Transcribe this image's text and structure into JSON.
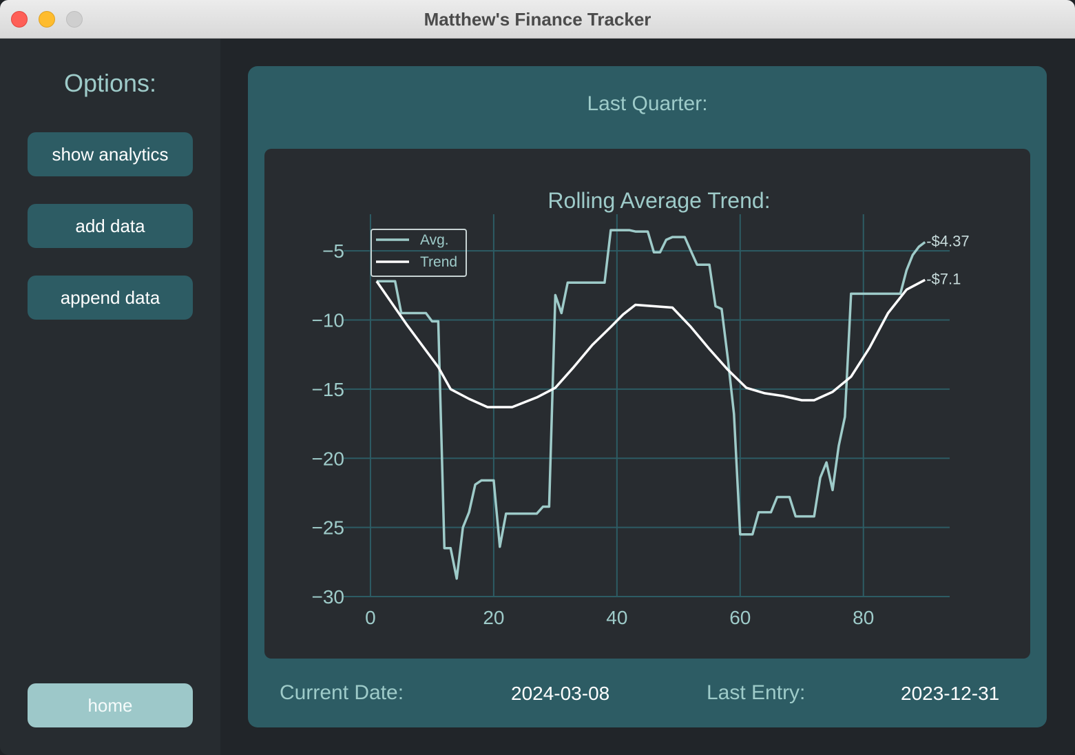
{
  "window": {
    "title": "Matthew's Finance Tracker"
  },
  "sidebar": {
    "title": "Options:",
    "buttons": [
      "show analytics",
      "add data",
      "append data"
    ],
    "home_label": "home"
  },
  "main": {
    "title": "Last Quarter:",
    "footer": {
      "current_date_label": "Current Date:",
      "current_date_value": "2024-03-08",
      "last_entry_label": "Last Entry:",
      "last_entry_value": "2023-12-31"
    }
  },
  "colors": {
    "avg_line": "#9ecbc9",
    "trend_line": "#ffffff",
    "grid": "#2d5c64",
    "panel": "#2d5c64",
    "text": "#9ecbc9"
  },
  "chart_data": {
    "type": "line",
    "title": "Rolling Average Trend:",
    "xlim": [
      -1,
      94
    ],
    "ylim": [
      -30,
      -2.6
    ],
    "xticks": [
      0,
      20,
      40,
      60,
      80
    ],
    "yticks": [
      -5,
      -10,
      -15,
      -20,
      -25,
      -30
    ],
    "ytick_labels": [
      "−5",
      "−10",
      "−15",
      "−20",
      "−25",
      "−30"
    ],
    "grid": true,
    "legend_position": "top-left",
    "series": [
      {
        "name": "Avg.",
        "end_label": "-$4.37",
        "x": [
          1,
          4,
          5,
          6,
          9,
          10,
          11,
          12,
          13,
          14,
          15,
          16,
          17,
          18,
          19,
          20,
          21,
          22,
          23,
          24,
          27,
          28,
          29,
          30,
          31,
          32,
          33,
          34,
          35,
          38,
          39,
          40,
          41,
          42,
          43,
          44,
          45,
          46,
          47,
          48,
          49,
          50,
          51,
          52,
          53,
          54,
          55,
          56,
          57,
          58,
          59,
          60,
          61,
          62,
          63,
          64,
          65,
          66,
          67,
          68,
          69,
          70,
          71,
          72,
          73,
          74,
          75,
          76,
          77,
          78,
          79,
          80,
          81,
          86,
          87,
          88,
          89,
          90
        ],
        "y": [
          -7.2,
          -7.2,
          -9.5,
          -9.5,
          -9.5,
          -10.1,
          -10.1,
          -26.5,
          -26.5,
          -28.7,
          -25,
          -23.9,
          -21.9,
          -21.6,
          -21.6,
          -21.6,
          -26.4,
          -24,
          -24,
          -24,
          -24,
          -23.5,
          -23.5,
          -8.2,
          -9.5,
          -7.3,
          -7.3,
          -7.3,
          -7.3,
          -7.3,
          -3.5,
          -3.5,
          -3.5,
          -3.5,
          -3.6,
          -3.6,
          -3.6,
          -5.1,
          -5.1,
          -4.2,
          -4.0,
          -4.0,
          -4.0,
          -5.0,
          -6.0,
          -6.0,
          -6.0,
          -9.0,
          -9.2,
          -12.8,
          -16.8,
          -25.5,
          -25.5,
          -25.5,
          -23.9,
          -23.9,
          -23.9,
          -22.8,
          -22.8,
          -22.8,
          -24.2,
          -24.2,
          -24.2,
          -24.2,
          -21.4,
          -20.3,
          -22.3,
          -19.1,
          -17.0,
          -8.1,
          -8.1,
          -8.1,
          -8.1,
          -8.1,
          -6.4,
          -5.3,
          -4.7,
          -4.37
        ]
      },
      {
        "name": "Trend",
        "end_label": "-$7.1",
        "x": [
          1,
          6,
          11,
          13,
          16,
          19,
          23,
          27,
          30,
          33,
          36,
          39,
          41,
          43,
          46,
          49,
          52,
          55,
          58,
          61,
          64,
          67,
          70,
          72,
          75,
          78,
          81,
          84,
          87,
          90
        ],
        "y": [
          -7.2,
          -10.4,
          -13.4,
          -15.0,
          -15.7,
          -16.3,
          -16.3,
          -15.6,
          -14.9,
          -13.4,
          -11.8,
          -10.5,
          -9.6,
          -8.9,
          -9.0,
          -9.1,
          -10.5,
          -12.1,
          -13.6,
          -14.9,
          -15.3,
          -15.5,
          -15.8,
          -15.8,
          -15.2,
          -14.1,
          -12.0,
          -9.5,
          -7.8,
          -7.1
        ]
      }
    ]
  }
}
